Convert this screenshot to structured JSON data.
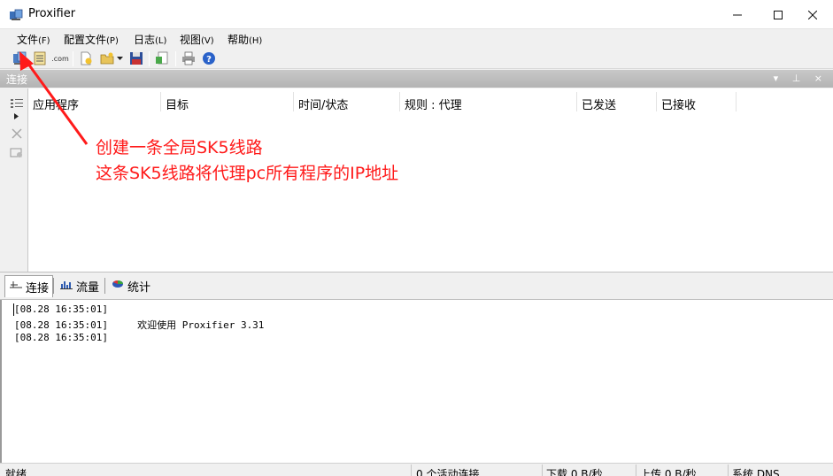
{
  "window": {
    "title": "Proxifier",
    "icons": {
      "app": "proxifier-app-icon",
      "minimize": "minimize-icon",
      "maximize": "maximize-icon",
      "close": "close-icon"
    }
  },
  "menu": [
    {
      "label": "文件",
      "accel": "(F)"
    },
    {
      "label": "配置文件",
      "accel": "(P)"
    },
    {
      "label": "日志",
      "accel": "(L)"
    },
    {
      "label": "视图",
      "accel": "(V)"
    },
    {
      "label": "帮助",
      "accel": "(H)"
    }
  ],
  "toolbar": {
    "icons": [
      "proxy-servers-icon",
      "proxification-rules-icon",
      "name-resolution-icon",
      "new-profile-icon",
      "open-profile-icon",
      "save-profile-icon",
      "export-icon",
      "print-icon",
      "help-icon"
    ],
    "com_text": ".com"
  },
  "connections_panel": {
    "title": "连接",
    "header_buttons": "▾ ⊥ ×",
    "columns": [
      "应用程序",
      "目标",
      "时间/状态",
      "规则 : 代理",
      "已发送",
      "已接收"
    ]
  },
  "side_toolbar": {
    "icons": [
      "connections-list-icon",
      "expand-arrow-icon",
      "close-connection-icon",
      "connection-details-icon"
    ]
  },
  "tabs": [
    {
      "label": "连接",
      "icon": "connections-tab-icon"
    },
    {
      "label": "流量",
      "icon": "traffic-chart-icon"
    },
    {
      "label": "统计",
      "icon": "statistics-pie-icon"
    }
  ],
  "log": [
    {
      "time": "[08.28 16:35:01]",
      "message": ""
    },
    {
      "time": "[08.28 16:35:01]",
      "message": "欢迎使用 Proxifier 3.31"
    },
    {
      "time": "[08.28 16:35:01]",
      "message": ""
    }
  ],
  "status": {
    "ready": "就绪",
    "active_connections": "0 个活动连接",
    "download": "下载 0 B/秒",
    "upload": "上传 0 B/秒",
    "dns": "系统 DNS"
  },
  "annotation": {
    "line1": "创建一条全局SK5线路",
    "line2": "这条SK5线路将代理pc所有程序的IP地址",
    "color": "#ff1a1a"
  }
}
